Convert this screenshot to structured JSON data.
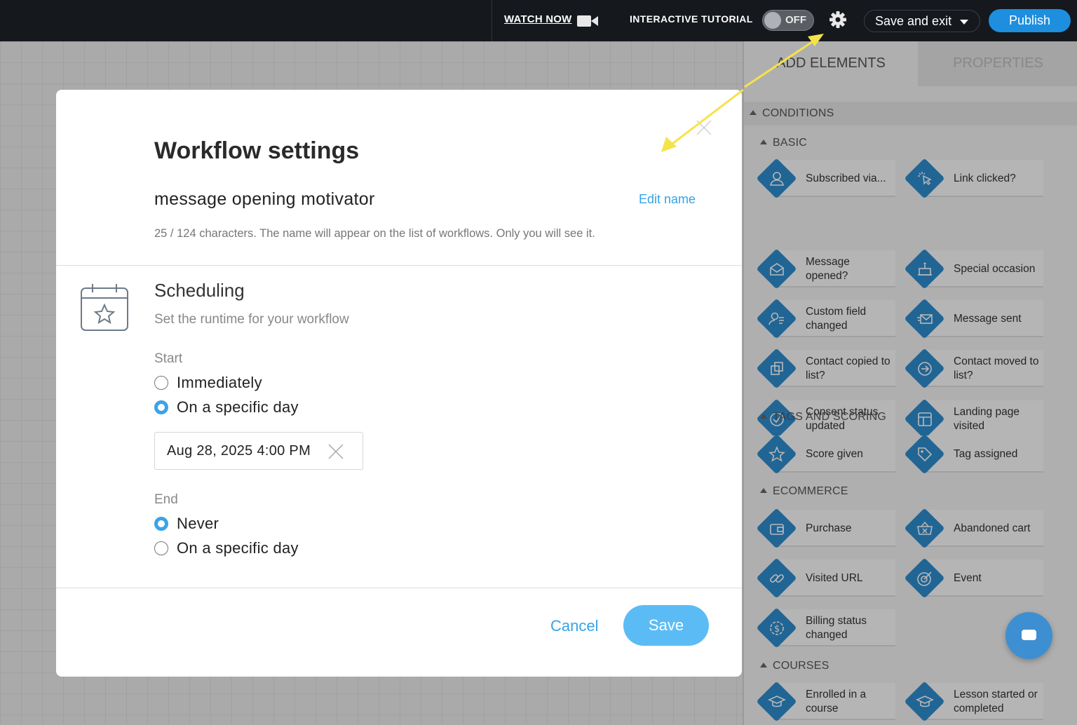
{
  "topbar": {
    "watch_now": "WATCH NOW",
    "tutorial_label": "INTERACTIVE TUTORIAL",
    "tutorial_toggle": "OFF",
    "save_exit": "Save and exit",
    "publish": "Publish"
  },
  "panel": {
    "tabs": [
      "ADD ELEMENTS",
      "PROPERTIES"
    ],
    "conditions_label": "CONDITIONS",
    "sections": {
      "basic": "BASIC",
      "tags_scoring": "TAGS AND SCORING",
      "ecommerce": "ECOMMERCE",
      "courses": "COURSES"
    },
    "tiles": {
      "subscribed": "Subscribed via...",
      "link_clicked": "Link clicked?",
      "message_opened": "Message opened?",
      "special_occasion": "Special occasion",
      "custom_field": "Custom field changed",
      "message_sent": "Message sent",
      "contact_copied": "Contact copied to list?",
      "contact_moved": "Contact moved to list?",
      "consent_status": "Consent status updated",
      "landing_page": "Landing page visited",
      "score_given": "Score given",
      "tag_assigned": "Tag assigned",
      "purchase": "Purchase",
      "abandoned_cart": "Abandoned cart",
      "visited_url": "Visited URL",
      "event": "Event",
      "billing_status": "Billing status changed",
      "enrolled_course": "Enrolled in a course",
      "lesson_started": "Lesson started or completed"
    },
    "tile_color": "#2f8ccf"
  },
  "modal": {
    "title": "Workflow settings",
    "workflow_name": "message opening motivator",
    "edit_name": "Edit name",
    "name_hint": "25 / 124 characters. The name will appear on the list of workflows. Only you will see it.",
    "scheduling_title": "Scheduling",
    "scheduling_sub": "Set the runtime for your workflow",
    "start_label": "Start",
    "start_options": [
      "Immediately",
      "On a specific day"
    ],
    "start_selected": "On a specific day",
    "start_date": "Aug 28, 2025 4:00 PM",
    "end_label": "End",
    "end_options": [
      "Never",
      "On a specific day"
    ],
    "end_selected": "Never",
    "cancel": "Cancel",
    "save": "Save"
  },
  "colors": {
    "accent": "#35a3e8",
    "publish": "#1e8ede",
    "annotation_arrow": "#f5e34a"
  }
}
